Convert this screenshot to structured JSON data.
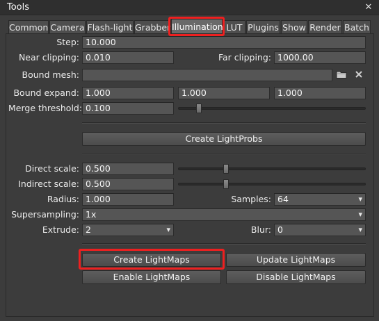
{
  "window": {
    "title": "Tools",
    "close_glyph": "✕"
  },
  "tabs": [
    {
      "label": "Common"
    },
    {
      "label": "Camera"
    },
    {
      "label": "Flash-light"
    },
    {
      "label": "Grabber"
    },
    {
      "label": "Illumination"
    },
    {
      "label": "LUT"
    },
    {
      "label": "Plugins"
    },
    {
      "label": "Show"
    },
    {
      "label": "Render"
    },
    {
      "label": "Batch"
    }
  ],
  "active_tab": "Illumination",
  "illumination": {
    "step": {
      "label": "Step:",
      "value": "10.000"
    },
    "near_clipping": {
      "label": "Near clipping:",
      "value": "0.010"
    },
    "far_clipping": {
      "label": "Far clipping:",
      "value": "1000.00"
    },
    "bound_mesh": {
      "label": "Bound mesh:",
      "value": "",
      "browse_icon": "folder-icon",
      "clear_icon": "clear-icon"
    },
    "bound_expand": {
      "label": "Bound expand:",
      "values": [
        "1.000",
        "1.000",
        "1.000"
      ]
    },
    "merge_threshold": {
      "label": "Merge threshold:",
      "value": "0.100",
      "slider_fraction": 0.06
    },
    "create_lightprobs": {
      "label": "Create LightProbs"
    },
    "direct_scale": {
      "label": "Direct scale:",
      "value": "0.500",
      "slider_fraction": 0.25
    },
    "indirect_scale": {
      "label": "Indirect scale:",
      "value": "0.500",
      "slider_fraction": 0.25
    },
    "radius": {
      "label": "Radius:",
      "value": "1.000"
    },
    "samples": {
      "label": "Samples:",
      "value": "64"
    },
    "supersampling": {
      "label": "Supersampling:",
      "value": "1x"
    },
    "extrude": {
      "label": "Extrude:",
      "value": "2"
    },
    "blur": {
      "label": "Blur:",
      "value": "0"
    },
    "buttons": {
      "create_lightmaps": "Create LightMaps",
      "update_lightmaps": "Update LightMaps",
      "enable_lightmaps": "Enable LightMaps",
      "disable_lightmaps": "Disable LightMaps"
    }
  },
  "highlight_color": "#ee2020"
}
